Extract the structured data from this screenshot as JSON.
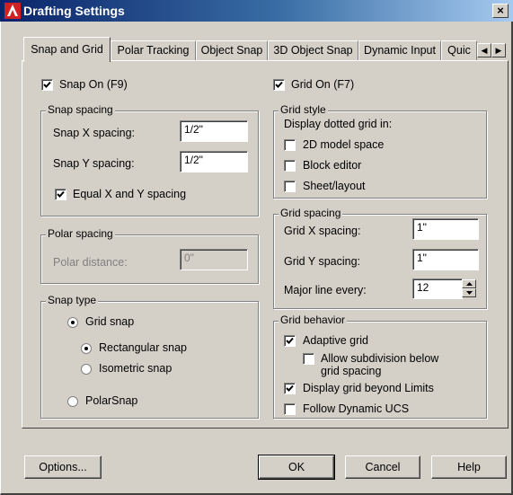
{
  "window": {
    "title": "Drafting Settings",
    "close_glyph": "×"
  },
  "tabs": [
    {
      "label": "Snap and Grid"
    },
    {
      "label": "Polar Tracking"
    },
    {
      "label": "Object Snap"
    },
    {
      "label": "3D Object Snap"
    },
    {
      "label": "Dynamic Input"
    },
    {
      "label": "Quic"
    }
  ],
  "snap_on": {
    "label": "Snap On (F9)",
    "checked": true
  },
  "grid_on": {
    "label": "Grid On (F7)",
    "checked": true
  },
  "snap_spacing": {
    "title": "Snap spacing",
    "x_label": "Snap X spacing:",
    "x_value": "1/2\"",
    "y_label": "Snap Y spacing:",
    "y_value": "1/2\"",
    "equal_label": "Equal X and Y spacing",
    "equal_checked": true
  },
  "polar_spacing": {
    "title": "Polar spacing",
    "distance_label": "Polar distance:",
    "distance_value": "0\""
  },
  "snap_type": {
    "title": "Snap type",
    "grid_snap": "Grid snap",
    "rectangular": "Rectangular snap",
    "isometric": "Isometric snap",
    "polarsnap": "PolarSnap"
  },
  "grid_style": {
    "title": "Grid style",
    "desc": "Display dotted grid in:",
    "model_space": "2D model space",
    "block_editor": "Block editor",
    "sheet_layout": "Sheet/layout"
  },
  "grid_spacing": {
    "title": "Grid spacing",
    "x_label": "Grid X spacing:",
    "x_value": "1\"",
    "y_label": "Grid Y spacing:",
    "y_value": "1\"",
    "major_label": "Major line every:",
    "major_value": "12"
  },
  "grid_behavior": {
    "title": "Grid behavior",
    "adaptive": "Adaptive grid",
    "adaptive_checked": true,
    "subdivision_line1": "Allow subdivision below",
    "subdivision_line2": "grid spacing",
    "beyond_limits": "Display grid beyond Limits",
    "beyond_checked": true,
    "follow_ucs": "Follow Dynamic UCS"
  },
  "buttons": {
    "options": "Options...",
    "ok": "OK",
    "cancel": "Cancel",
    "help": "Help"
  },
  "colors": {
    "titlebar": "#0a246a",
    "dialog_bg": "#d4d0c8",
    "app_icon": "#d32020"
  }
}
